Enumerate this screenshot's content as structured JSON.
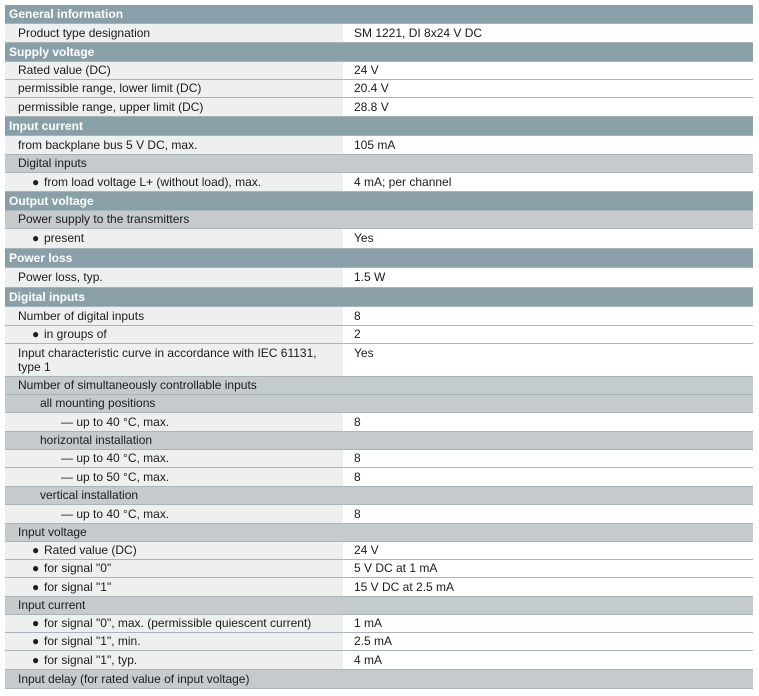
{
  "sections": {
    "general": "General information",
    "supply": "Supply voltage",
    "input_current": "Input current",
    "output_voltage": "Output voltage",
    "power_loss": "Power loss",
    "digital_inputs": "Digital inputs"
  },
  "rows": {
    "product_type": {
      "label": "Product type designation",
      "value": "SM 1221, DI 8x24 V DC"
    },
    "rated_value": {
      "label": "Rated value (DC)",
      "value": "24 V"
    },
    "lower_limit": {
      "label": "permissible range, lower limit (DC)",
      "value": "20.4 V"
    },
    "upper_limit": {
      "label": "permissible range, upper limit (DC)",
      "value": "28.8 V"
    },
    "backplane": {
      "label": "from backplane bus 5 V DC, max.",
      "value": "105 mA"
    },
    "digital_inputs_group": {
      "label": "Digital inputs"
    },
    "load_voltage": {
      "label": "from load voltage L+ (without load), max.",
      "value": "4 mA; per channel"
    },
    "power_supply_group": {
      "label": "Power supply to the transmitters"
    },
    "present": {
      "label": "present",
      "value": "Yes"
    },
    "power_loss_typ": {
      "label": "Power loss, typ.",
      "value": "1.5 W"
    },
    "num_inputs": {
      "label": "Number of digital inputs",
      "value": "8"
    },
    "in_groups": {
      "label": "in groups of",
      "value": "2"
    },
    "iec_curve": {
      "label": "Input characteristic curve in accordance with IEC 61131, type 1",
      "value": "Yes"
    },
    "simul_group": {
      "label": "Number of simultaneously controllable inputs"
    },
    "all_mounting": {
      "label": "all mounting positions"
    },
    "all_40": {
      "label": "— up to 40 °C, max.",
      "value": "8"
    },
    "horizontal": {
      "label": "horizontal installation"
    },
    "hor_40": {
      "label": "— up to 40 °C, max.",
      "value": "8"
    },
    "hor_50": {
      "label": "— up to 50 °C, max.",
      "value": "8"
    },
    "vertical": {
      "label": "vertical installation"
    },
    "ver_40": {
      "label": "— up to 40 °C, max.",
      "value": "8"
    },
    "input_voltage_group": {
      "label": "Input voltage"
    },
    "iv_rated": {
      "label": "Rated value (DC)",
      "value": "24 V"
    },
    "iv_sig0": {
      "label": "for signal \"0\"",
      "value": "5 V DC at 1 mA"
    },
    "iv_sig1": {
      "label": "for signal \"1\"",
      "value": "15 V DC at 2.5 mA"
    },
    "input_current_group": {
      "label": "Input current"
    },
    "ic_sig0": {
      "label": "for signal \"0\", max. (permissible quiescent current)",
      "value": "1 mA"
    },
    "ic_sig1_min": {
      "label": "for signal \"1\", min.",
      "value": "2.5 mA"
    },
    "ic_sig1_typ": {
      "label": "for signal \"1\", typ.",
      "value": "4 mA"
    },
    "input_delay_group": {
      "label": "Input delay (for rated value of input voltage)"
    }
  },
  "bullet": "●",
  "colors": {
    "section_bg": "#8aa0a8",
    "group_bg": "#c5cbcd",
    "label_bg": "#eef0f0",
    "value_bg": "#ffffff"
  }
}
